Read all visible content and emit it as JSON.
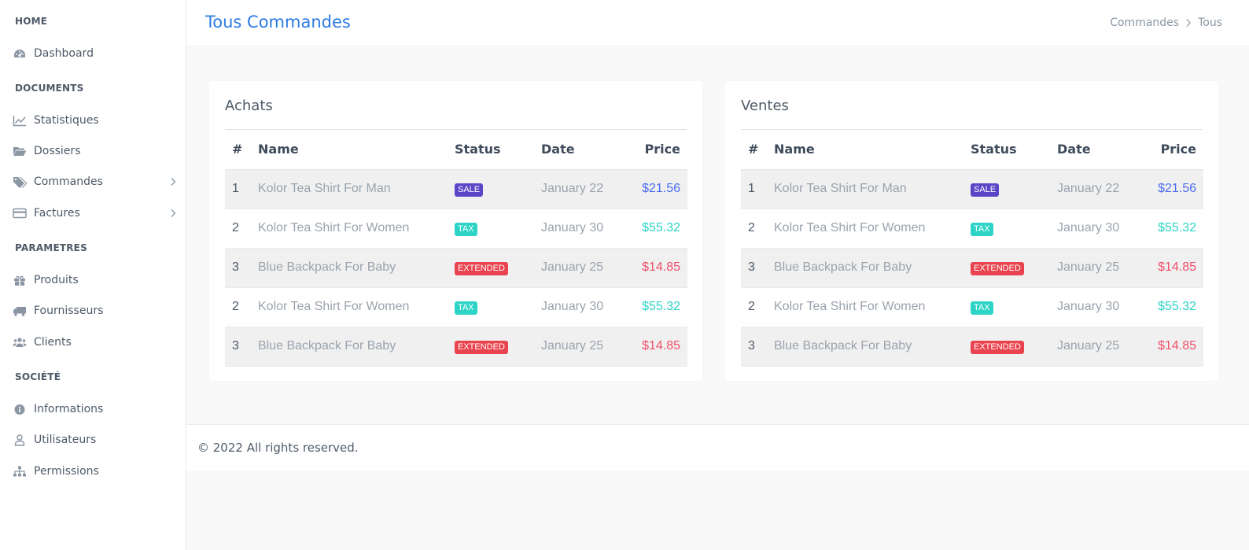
{
  "sidebar": {
    "sections": {
      "home": "HOME",
      "documents": "DOCUMENTS",
      "parametres": "PARAMETRES",
      "societe": "SOCIÉTÉ"
    },
    "items": {
      "dashboard": "Dashboard",
      "statistiques": "Statistiques",
      "dossiers": "Dossiers",
      "commandes": "Commandes",
      "factures": "Factures",
      "produits": "Produits",
      "fournisseurs": "Fournisseurs",
      "clients": "Clients",
      "informations": "Informations",
      "utilisateurs": "Utilisateurs",
      "permissions": "Permissions"
    },
    "icons": {
      "dashboard": "tachometer-icon",
      "statistiques": "line-chart-icon",
      "dossiers": "folder-open-icon",
      "commandes": "tags-icon",
      "factures": "credit-card-icon",
      "produits": "gift-icon",
      "fournisseurs": "truck-icon",
      "clients": "users-icon",
      "informations": "info-circle-icon",
      "utilisateurs": "user-icon",
      "permissions": "sitemap-icon"
    }
  },
  "header": {
    "title": "Tous Commandes",
    "breadcrumb": [
      "Commandes",
      "Tous"
    ]
  },
  "colors": {
    "accent": "#2c7be5",
    "sale": "#5c45c7",
    "tax": "#2dd4c5",
    "extended": "#e8434e",
    "price_blue": "#4a6cf2",
    "price_teal": "#2dd4c5",
    "price_red": "#ef4f6a"
  },
  "columns": {
    "num": "#",
    "name": "Name",
    "status": "Status",
    "date": "Date",
    "price": "Price"
  },
  "achats": {
    "title": "Achats",
    "rows": [
      {
        "num": "1",
        "name": "Kolor Tea Shirt For Man",
        "status": "SALE",
        "date": "January 22",
        "price": "$21.56"
      },
      {
        "num": "2",
        "name": "Kolor Tea Shirt For Women",
        "status": "TAX",
        "date": "January 30",
        "price": "$55.32"
      },
      {
        "num": "3",
        "name": "Blue Backpack For Baby",
        "status": "EXTENDED",
        "date": "January 25",
        "price": "$14.85"
      },
      {
        "num": "2",
        "name": "Kolor Tea Shirt For Women",
        "status": "TAX",
        "date": "January 30",
        "price": "$55.32"
      },
      {
        "num": "3",
        "name": "Blue Backpack For Baby",
        "status": "EXTENDED",
        "date": "January 25",
        "price": "$14.85"
      }
    ]
  },
  "ventes": {
    "title": "Ventes",
    "rows": [
      {
        "num": "1",
        "name": "Kolor Tea Shirt For Man",
        "status": "SALE",
        "date": "January 22",
        "price": "$21.56"
      },
      {
        "num": "2",
        "name": "Kolor Tea Shirt For Women",
        "status": "TAX",
        "date": "January 30",
        "price": "$55.32"
      },
      {
        "num": "3",
        "name": "Blue Backpack For Baby",
        "status": "EXTENDED",
        "date": "January 25",
        "price": "$14.85"
      },
      {
        "num": "2",
        "name": "Kolor Tea Shirt For Women",
        "status": "TAX",
        "date": "January 30",
        "price": "$55.32"
      },
      {
        "num": "3",
        "name": "Blue Backpack For Baby",
        "status": "EXTENDED",
        "date": "January 25",
        "price": "$14.85"
      }
    ]
  },
  "footer": {
    "text": "© 2022 All rights reserved."
  }
}
